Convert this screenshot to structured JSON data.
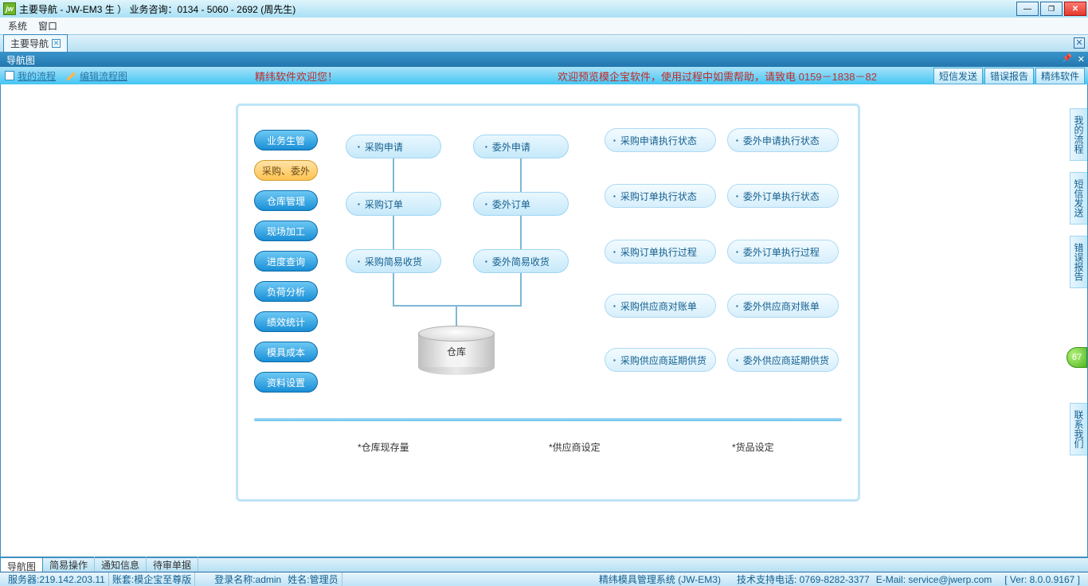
{
  "title": "主要导航 - JW-EM3            生 ）    业务咨询：0134 - 5060 - 2692 (周先生)",
  "menu": {
    "system": "系统",
    "window": "窗口"
  },
  "wintab": {
    "label": "主要导航"
  },
  "panel": {
    "title": "导航图"
  },
  "toolbar": {
    "my_flow": "我的流程",
    "edit_flow": "编辑流程图",
    "welcome": "精纬软件欢迎您！",
    "scroll": "欢迎预览模企宝软件，使用过程中如需帮助，请致电 ",
    "scroll_phone": "0159－1838－82",
    "btn_sms": "短信发送",
    "btn_err": "错误报告",
    "btn_jw": "精纬软件"
  },
  "cats": [
    "业务生管",
    "采购、委外",
    "仓库管理",
    "现场加工",
    "进度查询",
    "负荷分析",
    "绩效统计",
    "模具成本",
    "资料设置"
  ],
  "flow": {
    "c1": [
      "采购申请",
      "采购订单",
      "采购简易收货"
    ],
    "c2": [
      "委外申请",
      "委外订单",
      "委外简易收货"
    ],
    "c3": [
      "采购申请执行状态",
      "采购订单执行状态",
      "采购订单执行过程",
      "采购供应商对账单",
      "采购供应商延期供货"
    ],
    "c4": [
      "委外申请执行状态",
      "委外订单执行状态",
      "委外订单执行过程",
      "委外供应商对账单",
      "委外供应商延期供货"
    ],
    "warehouse": "仓库"
  },
  "footer_links": [
    "*仓库现存量",
    "*供应商设定",
    "*货品设定"
  ],
  "right_tabs": [
    "我的流程",
    "短信发送",
    "错误报告",
    "联系我们"
  ],
  "badge": "67",
  "subtabs": [
    "导航图",
    "简易操作",
    "通知信息",
    "待审单据"
  ],
  "status": {
    "server": "服务器:219.142.203.11",
    "account": "账套:模企宝至尊版",
    "login": "登录名称:admin",
    "name": "姓名:管理员",
    "product": "精纬模具管理系统 (JW-EM3)",
    "support": "技术支持电话: 0769-8282-3377",
    "email": "E-Mail: service@jwerp.com",
    "ver": "[ Ver: 8.0.0.9167 ]"
  }
}
